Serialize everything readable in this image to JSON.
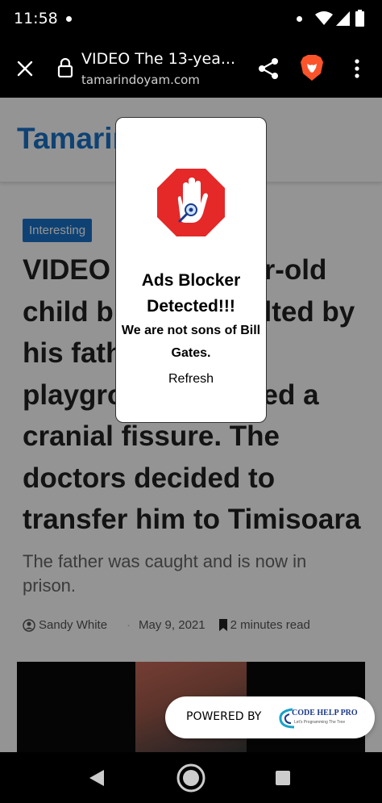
{
  "status_bar": {
    "time": "11:58"
  },
  "browser": {
    "page_title": "VIDEO The 13-yea...",
    "domain": "tamarindoyam.com"
  },
  "site": {
    "logo": "Tamarindo"
  },
  "article": {
    "category": "Interesting",
    "headline": "VIDEO The 13-year-old child brutally insulted by his father in the playground suffered a cranial fissure. The doctors decided to transfer him to Timisoara",
    "subtitle": "The father was caught and is now in prison.",
    "author": "Sandy White",
    "separator": "·",
    "date": "May 9, 2021",
    "read_time": "2 minutes read"
  },
  "modal": {
    "title": "Ads Blocker Detected!!!",
    "message": "We are not sons of Bill Gates.",
    "refresh_label": "Refresh"
  },
  "powered_by": {
    "label": "POWERED BY",
    "brand": "CODE HELP PRO",
    "tagline": "Let's Programming The Tree"
  },
  "colors": {
    "accent": "#1a73c8",
    "stop_sign": "#e52828",
    "browser_bg": "#000000",
    "brave_orange": "#fb542b"
  },
  "icons": {
    "close": "close-icon",
    "lock": "lock-icon",
    "share": "share-icon",
    "brave": "brave-lion-icon",
    "menu": "more-vert-icon",
    "wifi": "wifi-icon",
    "signal": "signal-icon",
    "battery": "battery-icon",
    "stop_hand": "stop-hand-icon",
    "author": "person-circle-icon",
    "bookmark": "bookmark-icon",
    "back": "back-triangle-icon",
    "home": "home-circle-icon",
    "recents": "recents-square-icon"
  }
}
